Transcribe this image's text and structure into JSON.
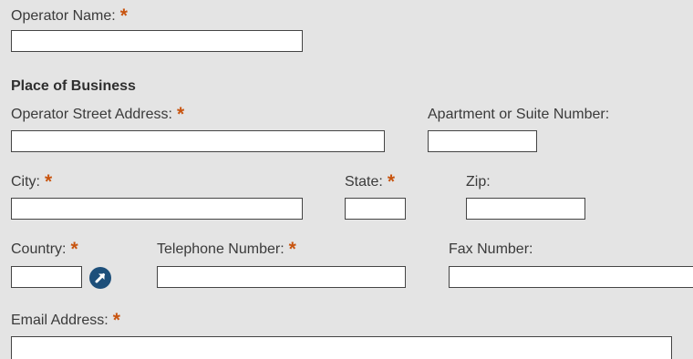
{
  "form": {
    "operator_name": {
      "label": "Operator Name:",
      "required_marker": "*",
      "value": ""
    },
    "section_title": "Place of Business",
    "street_address": {
      "label": "Operator Street Address:",
      "required_marker": "*",
      "value": ""
    },
    "apartment_suite": {
      "label": "Apartment or Suite Number:",
      "value": ""
    },
    "city": {
      "label": "City:",
      "required_marker": "*",
      "value": ""
    },
    "state": {
      "label": "State:",
      "required_marker": "*",
      "value": ""
    },
    "zip": {
      "label": "Zip:",
      "value": ""
    },
    "country": {
      "label": "Country:",
      "required_marker": "*",
      "value": "",
      "lookup_icon": "arrow-up-right-icon"
    },
    "telephone": {
      "label": "Telephone Number:",
      "required_marker": "*",
      "value": ""
    },
    "fax": {
      "label": "Fax Number:",
      "value": ""
    },
    "email": {
      "label": "Email Address:",
      "required_marker": "*",
      "value": ""
    }
  },
  "colors": {
    "background": "#e4e4e4",
    "required_marker": "#c8540f",
    "lookup_button": "#1d4f7a"
  }
}
